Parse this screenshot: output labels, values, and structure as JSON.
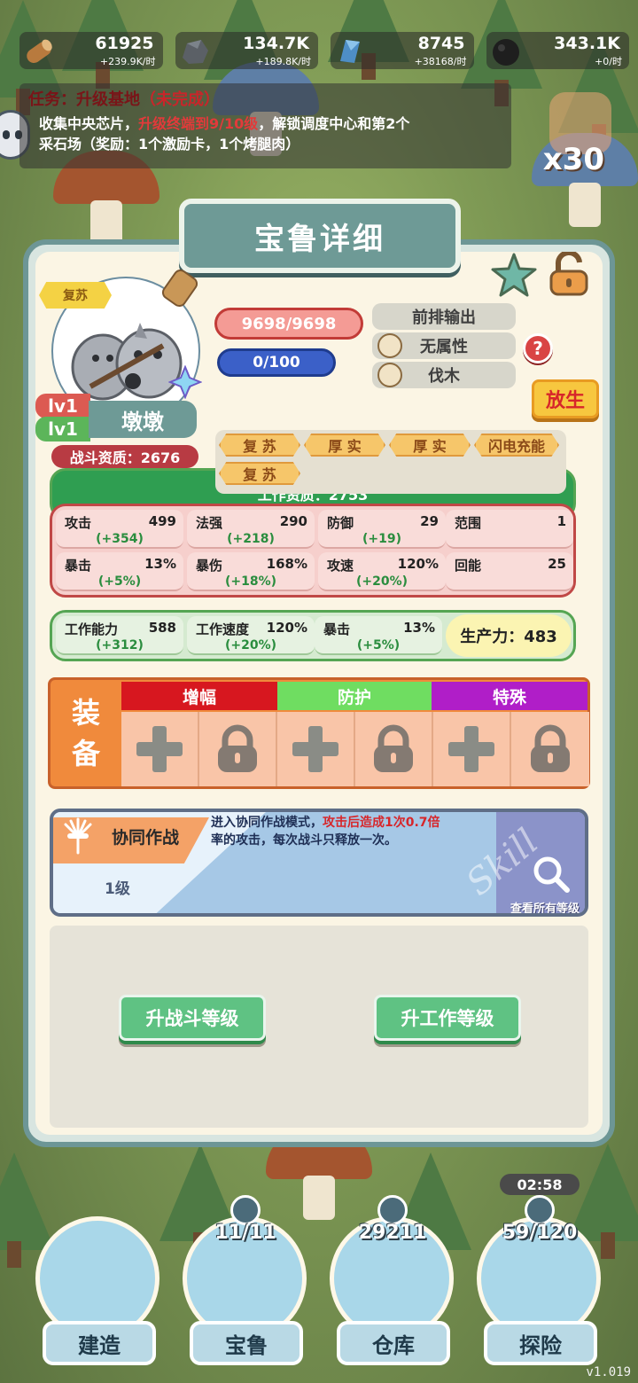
{
  "resources": [
    {
      "name": "wood",
      "value": "61925",
      "rate": "+239.9K/时",
      "color": "#b87a3e"
    },
    {
      "name": "stone",
      "value": "134.7K",
      "rate": "+189.8K/时",
      "color": "#5b6066"
    },
    {
      "name": "crystal",
      "value": "8745",
      "rate": "+38168/时",
      "color": "#4e8ec6"
    },
    {
      "name": "coal",
      "value": "343.1K",
      "rate": "+0/时",
      "color": "#1e1e1e"
    }
  ],
  "quest": {
    "prefix": "任务：升级基地",
    "status": "（未完成）",
    "line1_a": "收集中央芯片，",
    "line1_hl": "升级终端到9/10级",
    "line1_b": "，解锁调度中心和第2个",
    "line2": "采石场（奖励：1个激励卡，1个烤腿肉）"
  },
  "hand_count": "x30",
  "panel": {
    "title": "宝鲁详细",
    "revive_tag": "复苏",
    "battle_level": "lv1",
    "work_level": "lv1",
    "name": "墩墩",
    "battle_aptitude": "战斗资质：2676",
    "work_aptitude": "工作资质：2753",
    "hp": "9698/9698",
    "exp": "0/100",
    "role": "前排输出",
    "attribute": "无属性",
    "job": "伐木",
    "help": "?",
    "release": "放生"
  },
  "traits": [
    "复 苏",
    "厚 实",
    "厚 实",
    "闪电充能",
    "复 苏"
  ],
  "combat_stats": [
    {
      "key": "攻击",
      "value": "499",
      "bonus": "(+354)"
    },
    {
      "key": "法强",
      "value": "290",
      "bonus": "(+218)"
    },
    {
      "key": "防御",
      "value": "29",
      "bonus": "(+19)"
    },
    {
      "key": "范围",
      "value": "1",
      "bonus": ""
    },
    {
      "key": "暴击",
      "value": "13%",
      "bonus": "(+5%)"
    },
    {
      "key": "暴伤",
      "value": "168%",
      "bonus": "(+18%)"
    },
    {
      "key": "攻速",
      "value": "120%",
      "bonus": "(+20%)"
    },
    {
      "key": "回能",
      "value": "25",
      "bonus": ""
    }
  ],
  "work_stats": [
    {
      "key": "工作能力",
      "value": "588",
      "bonus": "(+312)"
    },
    {
      "key": "工作速度",
      "value": "120%",
      "bonus": "(+20%)"
    },
    {
      "key": "暴击",
      "value": "13%",
      "bonus": "(+5%)"
    }
  ],
  "productivity": "生产力：483",
  "equipment": {
    "label_1": "装",
    "label_2": "备",
    "headers": [
      {
        "label": "增幅",
        "color": "#d7171f"
      },
      {
        "label": "防护",
        "color": "#6fdd61"
      },
      {
        "label": "特殊",
        "color": "#b01ec8"
      }
    ]
  },
  "skill": {
    "name": "协同作战",
    "level": "1级",
    "desc_a": "进入协同作战模式，",
    "desc_hl": "攻击后造成1次0.7倍",
    "desc_b": "率的攻击，每次战斗只释放一次。",
    "watermark": "Skill",
    "view_all": "查看所有等级"
  },
  "upgrade": {
    "battle": "升战斗等级",
    "work": "升工作等级"
  },
  "timer": "02:58",
  "nav": [
    {
      "label": "建造",
      "count": ""
    },
    {
      "label": "宝鲁",
      "count": "11/11"
    },
    {
      "label": "仓库",
      "count": "29211"
    },
    {
      "label": "探险",
      "count": "59/120"
    }
  ],
  "version": "v1.019"
}
